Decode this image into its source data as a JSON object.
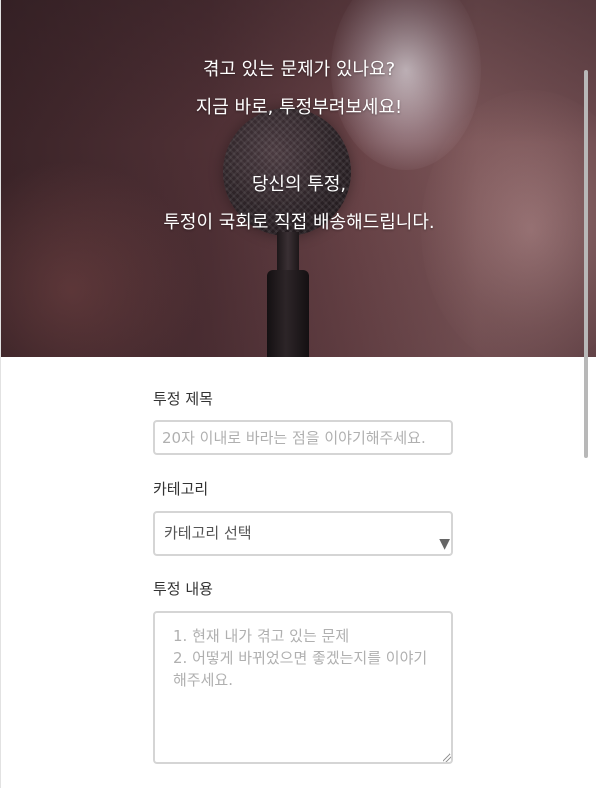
{
  "hero": {
    "line1": "겪고 있는 문제가 있나요?",
    "line2": "지금 바로, 투정부려보세요!",
    "line3": "당신의 투정,",
    "line4": "투정이 국회로 직접 배송해드립니다."
  },
  "form": {
    "title_label": "투정 제목",
    "title_placeholder": "20자 이내로 바라는 점을 이야기해주세요.",
    "category_label": "카테고리",
    "category_selected": "카테고리 선택",
    "content_label": "투정 내용",
    "content_placeholder": "1. 현재 내가 겪고 있는 문제\n2. 어떻게 바뀌었으면 좋겠는지를 이야기해주세요."
  },
  "icons": {
    "select_arrow": "dropdown-arrow-icon",
    "resize": "resize-grip-icon"
  },
  "colors": {
    "field_border": "#d5d5d5",
    "placeholder": "#b0b0b0",
    "label": "#333333"
  }
}
